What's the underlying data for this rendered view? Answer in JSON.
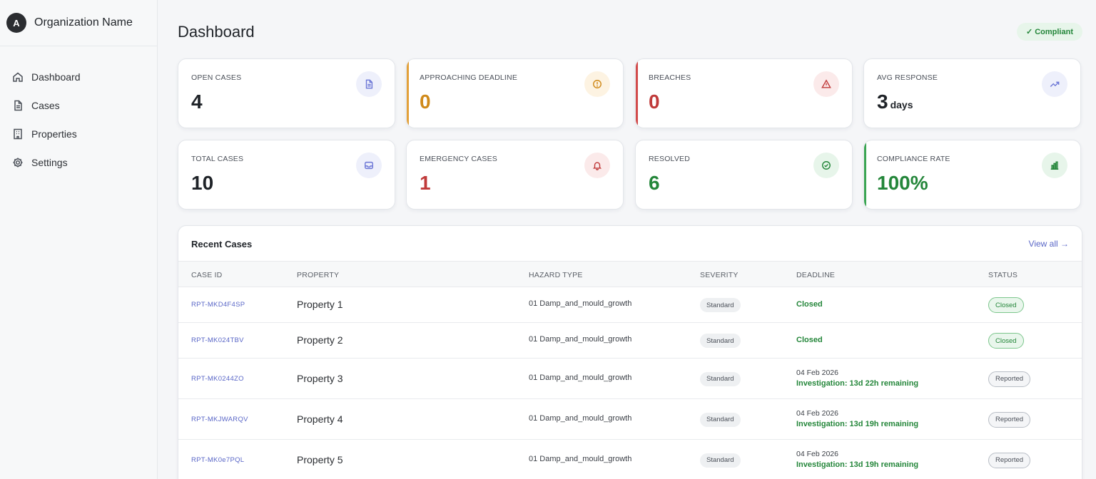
{
  "org": {
    "avatar_letter": "A",
    "name": "Organization Name"
  },
  "sidebar": {
    "items": [
      {
        "label": "Dashboard",
        "icon": "home-icon"
      },
      {
        "label": "Cases",
        "icon": "document-icon"
      },
      {
        "label": "Properties",
        "icon": "building-icon"
      },
      {
        "label": "Settings",
        "icon": "gear-icon"
      }
    ]
  },
  "header": {
    "title": "Dashboard",
    "compliance_badge": "✓ Compliant"
  },
  "stats": [
    {
      "label": "OPEN CASES",
      "value": "4",
      "unit": "",
      "color": "#1f2328",
      "accent": "",
      "icon": "document-icon",
      "icon_color": "#6b76d6",
      "icon_bg": "#eef0fb"
    },
    {
      "label": "APPROACHING DEADLINE",
      "value": "0",
      "unit": "",
      "color": "#d08a1a",
      "accent": "#e3a13a",
      "icon": "clock-icon",
      "icon_color": "#d08a1a",
      "icon_bg": "#fdf3e2"
    },
    {
      "label": "BREACHES",
      "value": "0",
      "unit": "",
      "color": "#c03a3a",
      "accent": "#d24b4b",
      "icon": "warning-icon",
      "icon_color": "#c03a3a",
      "icon_bg": "#fbeaea"
    },
    {
      "label": "AVG RESPONSE",
      "value": "3",
      "unit": "days",
      "color": "#1f2328",
      "accent": "",
      "icon": "trend-up-icon",
      "icon_color": "#6b76d6",
      "icon_bg": "#eef0fb"
    },
    {
      "label": "TOTAL CASES",
      "value": "10",
      "unit": "",
      "color": "#1f2328",
      "accent": "",
      "icon": "inbox-icon",
      "icon_color": "#6b76d6",
      "icon_bg": "#eef0fb"
    },
    {
      "label": "EMERGENCY CASES",
      "value": "1",
      "unit": "",
      "color": "#c03a3a",
      "accent": "",
      "icon": "bell-icon",
      "icon_color": "#c03a3a",
      "icon_bg": "#fbeaea"
    },
    {
      "label": "RESOLVED",
      "value": "6",
      "unit": "",
      "color": "#24863a",
      "accent": "",
      "icon": "check-circle-icon",
      "icon_color": "#24863a",
      "icon_bg": "#e7f5ea"
    },
    {
      "label": "COMPLIANCE RATE",
      "value": "100%",
      "unit": "",
      "color": "#24863a",
      "accent": "#3aa552",
      "icon": "bar-chart-icon",
      "icon_color": "#24863a",
      "icon_bg": "#e7f5ea"
    }
  ],
  "recent_cases": {
    "title": "Recent Cases",
    "view_all": "View all →",
    "columns": [
      "CASE ID",
      "PROPERTY",
      "HAZARD TYPE",
      "SEVERITY",
      "DEADLINE",
      "STATUS"
    ],
    "rows": [
      {
        "id": "RPT-MKD4F4SP",
        "property": "Property 1",
        "hazard": "01 Damp_and_mould_growth",
        "severity": "Standard",
        "deadline_date": "",
        "deadline_text": "Closed",
        "status": "Closed",
        "status_kind": "closed"
      },
      {
        "id": "RPT-MK024TBV",
        "property": "Property 2",
        "hazard": "01 Damp_and_mould_growth",
        "severity": "Standard",
        "deadline_date": "",
        "deadline_text": "Closed",
        "status": "Closed",
        "status_kind": "closed"
      },
      {
        "id": "RPT-MK0244ZO",
        "property": "Property 3",
        "hazard": "01 Damp_and_mould_growth",
        "severity": "Standard",
        "deadline_date": "04 Feb 2026",
        "deadline_text": "Investigation: 13d 22h remaining",
        "status": "Reported",
        "status_kind": "reported"
      },
      {
        "id": "RPT-MKJWARQV",
        "property": "Property 4",
        "hazard": "01 Damp_and_mould_growth",
        "severity": "Standard",
        "deadline_date": "04 Feb 2026",
        "deadline_text": "Investigation: 13d 19h remaining",
        "status": "Reported",
        "status_kind": "reported"
      },
      {
        "id": "RPT-MK0e7PQL",
        "property": "Property 5",
        "hazard": "01 Damp_and_mould_growth",
        "severity": "Standard",
        "deadline_date": "04 Feb 2026",
        "deadline_text": "Investigation: 13d 19h remaining",
        "status": "Reported",
        "status_kind": "reported"
      }
    ]
  }
}
